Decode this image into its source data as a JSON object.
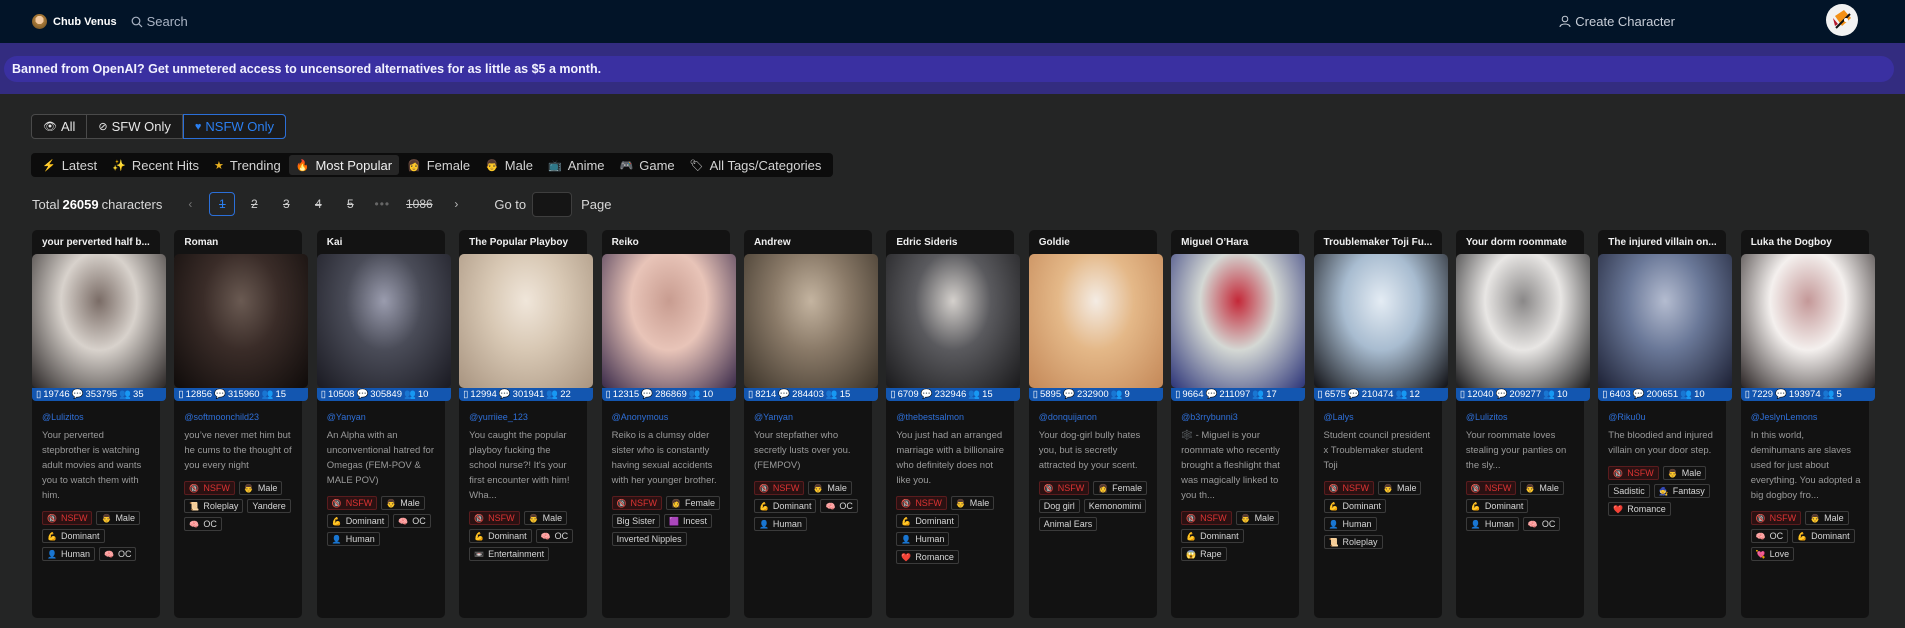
{
  "header": {
    "brand": "Chub Venus",
    "search_label": "Search",
    "create_label": "Create Character"
  },
  "banner": "Banned from OpenAI? Get unmetered access to uncensored alternatives for as little as $5 a month.",
  "content_filter": {
    "options": [
      {
        "icon": "eye-icon",
        "label": "All"
      },
      {
        "icon": "eye-slash-icon",
        "label": "SFW Only"
      },
      {
        "icon": "heart-icon",
        "label": "NSFW Only"
      }
    ],
    "selected": "NSFW Only"
  },
  "categories": [
    {
      "icon": "lightning-icon",
      "label": "Latest"
    },
    {
      "icon": "sparkles-icon",
      "label": "Recent Hits"
    },
    {
      "icon": "star-icon",
      "label": "Trending"
    },
    {
      "icon": "fire-icon",
      "label": "Most Popular"
    },
    {
      "icon": "female-icon",
      "label": "Female"
    },
    {
      "icon": "male-icon",
      "label": "Male"
    },
    {
      "icon": "tv-icon",
      "label": "Anime"
    },
    {
      "icon": "gamepad-icon",
      "label": "Game"
    },
    {
      "icon": "tags-icon",
      "label": "All Tags/Categories"
    }
  ],
  "selected_category": "Most Popular",
  "pagination": {
    "total_prefix": "Total",
    "total": "26059",
    "total_suffix": "characters",
    "pages": [
      "1",
      "2",
      "3",
      "4",
      "5",
      "•••",
      "1086"
    ],
    "current": "1",
    "goto_label": "Go to",
    "goto_value": "",
    "page_label": "Page"
  },
  "cards": [
    {
      "title": "your perverted half b...",
      "tokens": "19746",
      "chats": "353795",
      "users": "35",
      "author": "@Lulizitos",
      "desc": "Your perverted stepbrother is watching adult movies and wants you to watch them with him.",
      "tags": [
        "NSFW",
        "Male",
        "Dominant",
        "Human",
        "OC"
      ],
      "img": [
        "#d8d2cc",
        "#2a2626",
        "#7a6c66"
      ]
    },
    {
      "title": "Roman",
      "tokens": "12856",
      "chats": "315960",
      "users": "15",
      "author": "@softmoonchild23",
      "desc": "you’ve never met him but he cums to the thought of you every night",
      "tags": [
        "NSFW",
        "Male",
        "Roleplay",
        "Yandere",
        "OC"
      ],
      "img": [
        "#3a2c28",
        "#0f0b0a",
        "#6a5a52"
      ]
    },
    {
      "title": "Kai",
      "tokens": "10508",
      "chats": "305849",
      "users": "10",
      "author": "@Yanyan",
      "desc": "An Alpha with an unconventional hatred for Omegas (FEM-POV & MALE POV)",
      "tags": [
        "NSFW",
        "Male",
        "Dominant",
        "OC",
        "Human"
      ],
      "img": [
        "#4a4c58",
        "#1a1a22",
        "#9a9cae"
      ]
    },
    {
      "title": "The Popular Playboy",
      "tokens": "12994",
      "chats": "301941",
      "users": "22",
      "author": "@yurriiee_123",
      "desc": "You caught the popular playboy fucking the school nurse?! It's your first encounter with him! Wha...",
      "tags": [
        "NSFW",
        "Male",
        "Dominant",
        "OC",
        "Entertainment"
      ],
      "img": [
        "#d8c8b4",
        "#a89480",
        "#f0e6da"
      ]
    },
    {
      "title": "Reiko",
      "tokens": "12315",
      "chats": "286869",
      "users": "10",
      "author": "@Anonymous",
      "desc": "Reiko is a clumsy older sister who is constantly having sexual accidents with her younger brother.",
      "tags": [
        "NSFW",
        "Female",
        "Big Sister",
        "Incest",
        "Inverted Nipples"
      ],
      "img": [
        "#e8c4b8",
        "#3a2a4a",
        "#c89c90"
      ]
    },
    {
      "title": "Andrew",
      "tokens": "8214",
      "chats": "284403",
      "users": "15",
      "author": "@Yanyan",
      "desc": "Your stepfather who secretly lusts over you. (FEMPOV)",
      "tags": [
        "NSFW",
        "Male",
        "Dominant",
        "OC",
        "Human"
      ],
      "img": [
        "#8a7a68",
        "#3a3228",
        "#c4b4a0"
      ]
    },
    {
      "title": "Edric Sideris",
      "tokens": "6709",
      "chats": "232946",
      "users": "15",
      "author": "@thebestsalmon",
      "desc": "You just had an arranged marriage with a billionaire who definitely does not like you.",
      "tags": [
        "NSFW",
        "Male",
        "Dominant",
        "Human",
        "Romance"
      ],
      "img": [
        "#5a5a5e",
        "#1a1a1c",
        "#d4d0cc"
      ]
    },
    {
      "title": "Goldie",
      "tokens": "5895",
      "chats": "232900",
      "users": "9",
      "author": "@donquijanon",
      "desc": "Your dog-girl bully hates you, but is secretly attracted by your scent.",
      "tags": [
        "NSFW",
        "Female",
        "Dog girl",
        "Kemonomimi",
        "Animal Ears"
      ],
      "img": [
        "#e4b888",
        "#c48858",
        "#f4ece4"
      ]
    },
    {
      "title": "Miguel O’Hara",
      "tokens": "9664",
      "chats": "211097",
      "users": "17",
      "author": "@b3rrybunni3",
      "desc": "🕸️ - Miguel is your roommate who recently brought a fleshlight that was magically linked to you th...",
      "tags": [
        "NSFW",
        "Male",
        "Dominant",
        "Rape"
      ],
      "img": [
        "#d4d8d4",
        "#2c3478",
        "#c42838"
      ]
    },
    {
      "title": "Troublemaker Toji Fu...",
      "tokens": "6575",
      "chats": "210474",
      "users": "12",
      "author": "@Lalys",
      "desc": "Student council president x Troublemaker student Toji",
      "tags": [
        "NSFW",
        "Male",
        "Dominant",
        "Human",
        "Roleplay"
      ],
      "img": [
        "#a8bcd0",
        "#101014",
        "#e4ecf4"
      ]
    },
    {
      "title": "Your dorm roommate",
      "tokens": "12040",
      "chats": "209277",
      "users": "10",
      "author": "@Lulizitos",
      "desc": "Your roommate loves stealing your panties on the sly...",
      "tags": [
        "NSFW",
        "Male",
        "Dominant",
        "Human",
        "OC"
      ],
      "img": [
        "#e8e6e4",
        "#1a1a1c",
        "#8a8888"
      ]
    },
    {
      "title": "The injured villain on...",
      "tokens": "6403",
      "chats": "200651",
      "users": "10",
      "author": "@Riku0u",
      "desc": "The bloodied and injured villain on your door step.",
      "tags": [
        "NSFW",
        "Male",
        "Sadistic",
        "Fantasy",
        "Romance"
      ],
      "img": [
        "#6a7898",
        "#1c2034",
        "#b4bcd0"
      ]
    },
    {
      "title": "Luka the Dogboy",
      "tokens": "7229",
      "chats": "193974",
      "users": "5",
      "author": "@JeslynLemons",
      "desc": "In this world, demihumans are slaves used for just about everything. You adopted a big dogboy fro...",
      "tags": [
        "NSFW",
        "Male",
        "OC",
        "Dominant",
        "Love"
      ],
      "img": [
        "#f4f0ee",
        "#2a2424",
        "#c49898"
      ]
    }
  ],
  "tag_icons": {
    "NSFW": "🔞",
    "Male": "👨",
    "Female": "👩",
    "Dominant": "💪",
    "Human": "👤",
    "OC": "🧠",
    "Roleplay": "📜",
    "Entertainment": "📼",
    "Incest": "🟪",
    "Romance": "❤️",
    "Rape": "😱",
    "Fantasy": "🧙",
    "Love": "💘"
  }
}
